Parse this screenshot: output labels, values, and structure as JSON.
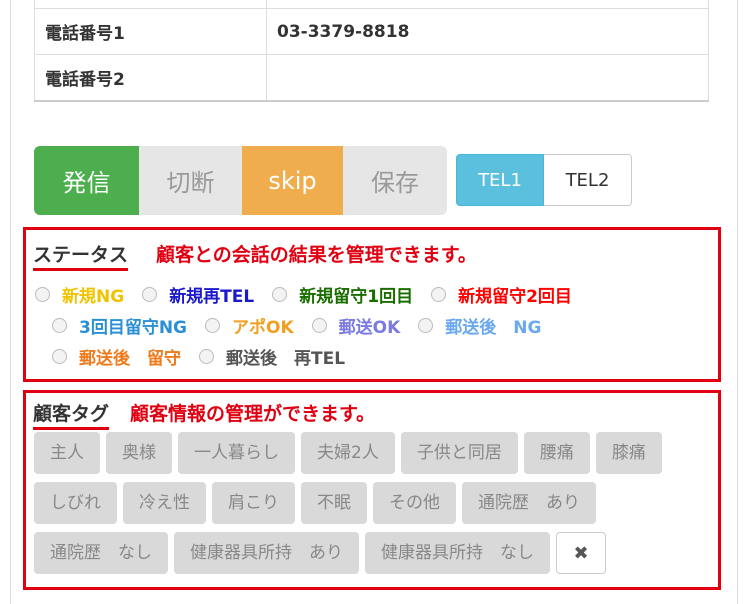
{
  "contact_table": {
    "rows": [
      {
        "key": "",
        "value": ""
      },
      {
        "key": "電話番号1",
        "value": "03-3379-8818"
      },
      {
        "key": "電話番号2",
        "value": ""
      }
    ]
  },
  "call_buttons": {
    "send": "発信",
    "cut": "切断",
    "skip": "skip",
    "save": "保存"
  },
  "tel_buttons": {
    "tel1": "TEL1",
    "tel2": "TEL2"
  },
  "status_section": {
    "title": "ステータス",
    "annotation": "顧客との会話の結果を管理できます。",
    "options": [
      {
        "label": "新規NG",
        "color": "#f0c300"
      },
      {
        "label": "新規再TEL",
        "color": "#1a1acc"
      },
      {
        "label": "新規留守1回目",
        "color": "#1a6e00"
      },
      {
        "label": "新規留守2回目",
        "color": "#ff0000"
      },
      {
        "label": "3回目留守NG",
        "color": "#2b8fd6"
      },
      {
        "label": "アポOK",
        "color": "#f0a020"
      },
      {
        "label": "郵送OK",
        "color": "#7a7ae0"
      },
      {
        "label": "郵送後　NG",
        "color": "#6aa8f0"
      },
      {
        "label": "郵送後　留守",
        "color": "#f07a1a"
      },
      {
        "label": "郵送後　再TEL",
        "color": "#555555"
      }
    ]
  },
  "tag_section": {
    "title": "顧客タグ",
    "annotation": "顧客情報の管理ができます。",
    "tags_row1": [
      "主人",
      "奥様",
      "一人暮らし",
      "夫婦2人",
      "子供と同居",
      "腰痛",
      "膝痛"
    ],
    "tags_row2": [
      "しびれ",
      "冷え性",
      "肩こり",
      "不眠",
      "その他",
      "通院歴　あり"
    ],
    "tags_row3": [
      "通院歴　なし",
      "健康器具所持　あり",
      "健康器具所持　なし"
    ],
    "clear_icon": "✖"
  }
}
